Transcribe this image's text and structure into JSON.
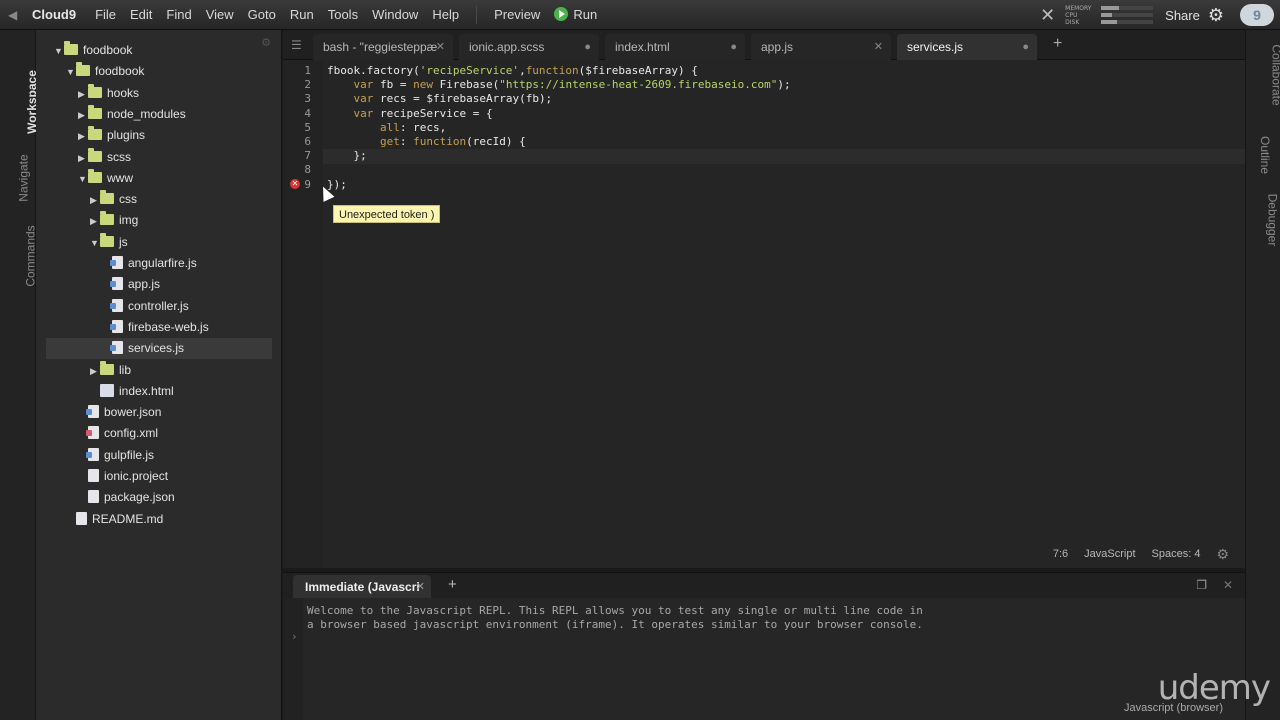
{
  "menubar": {
    "brand": "Cloud9",
    "items": [
      "File",
      "Edit",
      "Find",
      "View",
      "Goto",
      "Run",
      "Tools",
      "Window",
      "Help"
    ],
    "preview_label": "Preview",
    "run_label": "Run",
    "meter_labels": [
      "MEMORY",
      "CPU",
      "DISK"
    ],
    "meter_levels": [
      0.35,
      0.2,
      0.3
    ],
    "share_label": "Share",
    "cloud_badge": "9"
  },
  "left_tabs": [
    "Workspace",
    "Navigate",
    "Commands"
  ],
  "right_tabs": [
    "Collaborate",
    "Outline",
    "Debugger"
  ],
  "tree": [
    {
      "label": "foodbook",
      "type": "folder",
      "open": true
    },
    {
      "label": "foodbook",
      "type": "folder",
      "open": true
    },
    {
      "label": "hooks",
      "type": "folder",
      "open": false
    },
    {
      "label": "node_modules",
      "type": "folder",
      "open": false
    },
    {
      "label": "plugins",
      "type": "folder",
      "open": false
    },
    {
      "label": "scss",
      "type": "folder",
      "open": false
    },
    {
      "label": "www",
      "type": "folder",
      "open": true
    },
    {
      "label": "css",
      "type": "folder",
      "open": false
    },
    {
      "label": "img",
      "type": "folder",
      "open": false
    },
    {
      "label": "js",
      "type": "folder",
      "open": true
    },
    {
      "label": "angularfire.js",
      "type": "js"
    },
    {
      "label": "app.js",
      "type": "js"
    },
    {
      "label": "controller.js",
      "type": "js"
    },
    {
      "label": "firebase-web.js",
      "type": "js"
    },
    {
      "label": "services.js",
      "type": "js"
    },
    {
      "label": "lib",
      "type": "folder",
      "open": false
    },
    {
      "label": "index.html",
      "type": "html"
    },
    {
      "label": "bower.json",
      "type": "js"
    },
    {
      "label": "config.xml",
      "type": "xml"
    },
    {
      "label": "gulpfile.js",
      "type": "js"
    },
    {
      "label": "ionic.project",
      "type": "file"
    },
    {
      "label": "package.json",
      "type": "file"
    },
    {
      "label": "README.md",
      "type": "file"
    }
  ],
  "editor_tabs": [
    {
      "label": "bash - \"reggiesteppæ"
    },
    {
      "label": "ionic.app.scss"
    },
    {
      "label": "index.html"
    },
    {
      "label": "app.js"
    },
    {
      "label": "services.js"
    }
  ],
  "code_lines": [
    "fbook.factory('recipeService',function($firebaseArray) {",
    "    var fb = new Firebase(\"https://intense-heat-2609.firebaseio.com\");",
    "    var recs = $firebaseArray(fb);",
    "    var recipeService = {",
    "        all: recs,",
    "        get: function(recId) {",
    "    };",
    "",
    "});"
  ],
  "tooltip": "Unexpected token )",
  "status": {
    "position": "7:6",
    "mode": "JavaScript",
    "spaces": "Spaces: 4"
  },
  "repl": {
    "tab_label": "Immediate (Javascri",
    "lines": [
      "Welcome to the Javascript REPL. This REPL allows you to test any single or multi line code in",
      "a browser based javascript environment (iframe). It operates similar to your browser console."
    ],
    "mode": "Javascript (browser)"
  },
  "watermark": "udemy"
}
